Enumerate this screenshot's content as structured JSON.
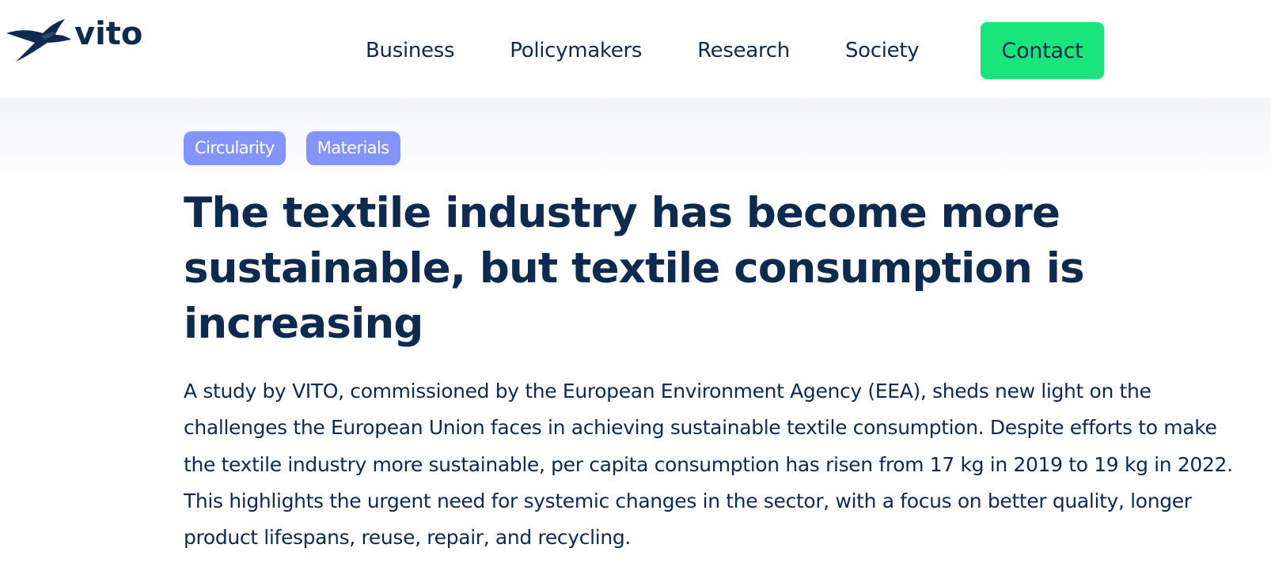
{
  "header": {
    "logo": {
      "text": "vito",
      "icon": "bird-logo-icon"
    },
    "nav": [
      {
        "label": "Business"
      },
      {
        "label": "Policymakers"
      },
      {
        "label": "Research"
      },
      {
        "label": "Society"
      }
    ],
    "contact_label": "Contact"
  },
  "article": {
    "tags": [
      {
        "label": "Circularity"
      },
      {
        "label": "Materials"
      }
    ],
    "title": "The textile industry has become more sustainable, but textile consumption is increasing",
    "intro": "A study by VITO, commissioned by the European Environment Agency (EEA), sheds new light on the challenges the European Union faces in achieving sustainable textile consumption. Despite efforts to make the textile industry more sustainable, per capita consumption has risen from 17 kg in 2019 to 19 kg in 2022. This highlights the urgent need for systemic changes in the sector, with a focus on better quality, longer product lifespans, reuse, repair, and recycling."
  },
  "colors": {
    "brand_navy": "#0e2a4f",
    "contact_green": "#19e57a",
    "tag_purple": "#8494ff",
    "hero_bg": "#f3f4f8"
  }
}
